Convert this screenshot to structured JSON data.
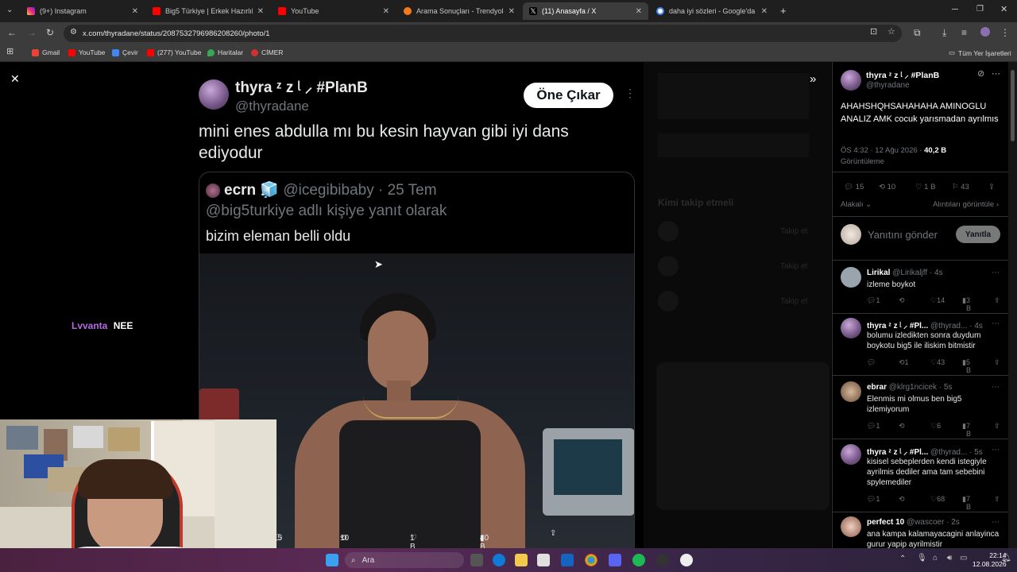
{
  "tabs": [
    {
      "title": "(9+) Instagram",
      "color": "#d6249f"
    },
    {
      "title": "Big5 Türkiye | Erkek Hazırlık Sez",
      "color": "#ff0000"
    },
    {
      "title": "YouTube",
      "color": "#ff0000"
    },
    {
      "title": "Arama Sonuçları - Trendyol",
      "color": "#f27a1a"
    },
    {
      "title": "(11) Anasayfa / X",
      "color": "#000000"
    },
    {
      "title": "daha iyi sözleri - Google'da Ara",
      "color": "#4285f4"
    }
  ],
  "address": {
    "url": "x.com/thyradane/status/2087532796986208260/photo/1"
  },
  "bookmarks": [
    "Gmail",
    "YouTube",
    "Çevir",
    "(277) YouTube",
    "Haritalar",
    "CİMER"
  ],
  "bookmarks_right": "Tüm Yer İşaretleri",
  "tweet": {
    "display_name": "thyra ᶻ z ᶩ ⸝ #PlanB",
    "handle": "@thyradane",
    "highlight_button": "Öne Çıkar",
    "text": "mini enes abdulla mı bu kesin hayvan gibi iyi dans ediyodur",
    "quote": {
      "name": "ecrn 🧊",
      "handle": "@icegibibaby",
      "date": "· 25 Tem",
      "reply_to": "@big5turkiye adlı kişiye yanıt olarak",
      "text": "bizim eleman belli oldu"
    },
    "stats": {
      "replies": "15",
      "retweets": "10",
      "likes": "1 B",
      "views": "40 B"
    }
  },
  "overlay": {
    "name": "Lvvanta",
    "text": "NEE"
  },
  "side": {
    "display_name": "thyra ᶻ z ᶩ ⸝ #PlanB",
    "handle": "@thyradane",
    "text": "AHAHSHQHSAHAHAHA AMINOGLU ANALIZ AMK cocuk yarısmadan ayrılmıs",
    "time": "ÖS 4:32 · 12 Ağu 2026 ·",
    "views": "40,2 B",
    "views_label": "Görüntüleme",
    "stats": {
      "replies": "15",
      "retweets": "10",
      "likes": "1 B",
      "bookmarks": "43"
    },
    "sort": "Alakalı",
    "quotes_link": "Alıntıları görüntüle",
    "reply_placeholder": "Yanıtını gönder",
    "reply_button": "Yanıtla"
  },
  "replies": [
    {
      "name": "Lirikal",
      "handle": "@Lirikaljff · 4s",
      "text": "izleme boykot",
      "stats": [
        "1",
        "",
        "14",
        "3 B"
      ]
    },
    {
      "name": "thyra ᶻ z ᶩ ⸝ #Pl...",
      "handle": "@thyrad... · 4s",
      "text": "bolumu izledikten sonra duydum boykotu big5 ile iliskim bitmistir",
      "stats": [
        "",
        "1",
        "43",
        "5 B"
      ]
    },
    {
      "name": "ebrar",
      "handle": "@klrg1ncicek · 5s",
      "text": "Elenmis mi olmus ben big5 izlemiyorum",
      "stats": [
        "1",
        "",
        "6",
        "7 B"
      ]
    },
    {
      "name": "thyra ᶻ z ᶩ ⸝ #Pl...",
      "handle": "@thyrad... · 5s",
      "text": "kisisel sebeplerden kendi istegiyle ayrilmis dediler ama tam sebebini spylemediler",
      "stats": [
        "1",
        "",
        "68",
        "7 B"
      ]
    },
    {
      "name": "perfect 10",
      "handle": "@wascoer · 2s",
      "text": "ana kampa kalamayacagini anlayinca gurur yapip ayrilmistir",
      "stats": [
        "",
        "",
        "",
        ""
      ]
    }
  ],
  "background_ghost": {
    "who_to_follow": "Kimi takip etmeli",
    "follow": "Takip et"
  },
  "taskbar": {
    "search": "Ara",
    "time": "22:14",
    "date": "12.08.2026"
  }
}
